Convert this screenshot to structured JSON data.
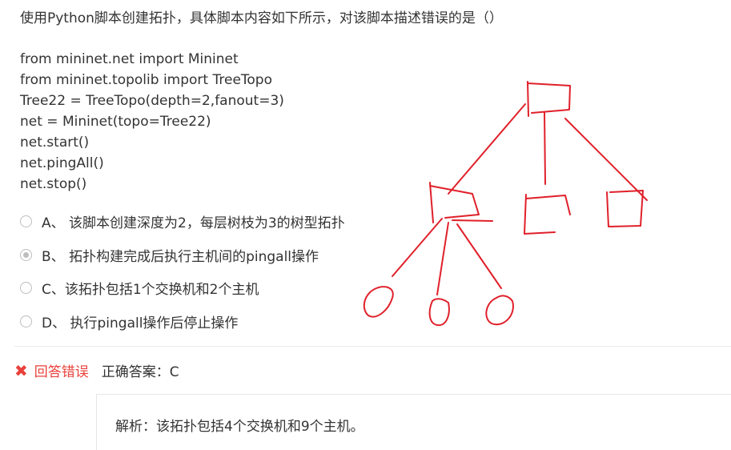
{
  "question": {
    "text": "使用Python脚本创建拓扑，具体脚本内容如下所示，对该脚本描述错误的是（）"
  },
  "code": {
    "lines": [
      "from mininet.net import Mininet",
      "from mininet.topolib import TreeTopo",
      "Tree22 = TreeTopo(depth=2,fanout=3)",
      "net = Mininet(topo=Tree22)",
      "net.start()",
      "net.pingAll()",
      "net.stop()"
    ]
  },
  "options": [
    {
      "label": "A、 该脚本创建深度为2，每层树枝为3的树型拓扑",
      "selected": false
    },
    {
      "label": "B、 拓扑构建完成后执行主机间的pingall操作",
      "selected": true
    },
    {
      "label": "C、该拓扑包括1个交换机和2个主机",
      "selected": false
    },
    {
      "label": "D、 执行pingall操作后停止操作",
      "selected": false
    }
  ],
  "result": {
    "icon": "x-mark-icon",
    "status": "回答错误",
    "correct_answer": "正确答案：C",
    "status_color": "#e8413a"
  },
  "explanation": {
    "text": "解析：该拓扑包括4个交换机和9个主机。"
  },
  "annotation": {
    "color": "#e0202a"
  }
}
